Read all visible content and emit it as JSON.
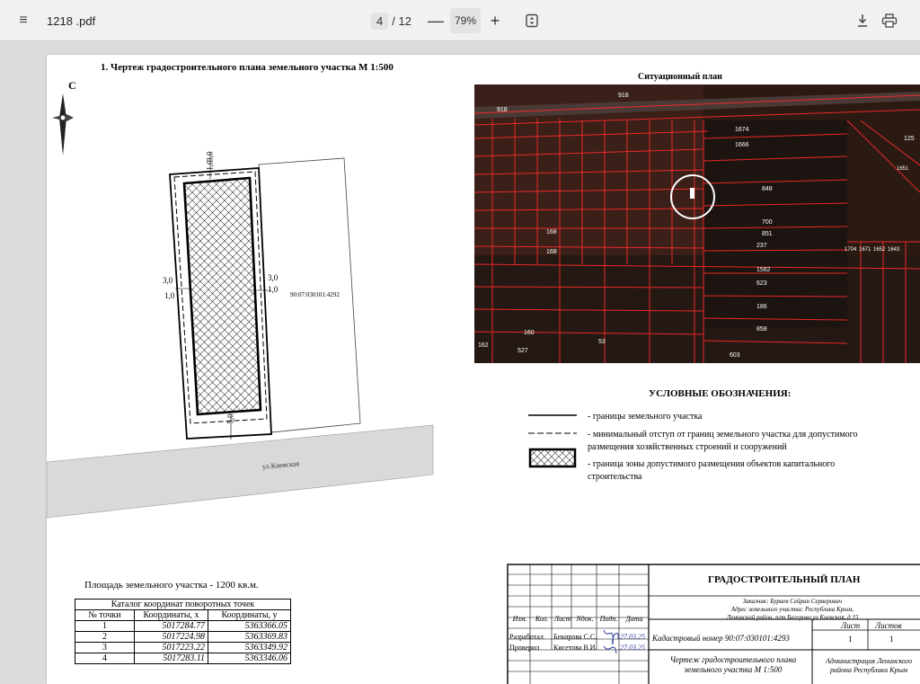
{
  "toolbar": {
    "file_name": "1218 .pdf",
    "page_current": "4",
    "page_total": "/ 12",
    "zoom": "79%",
    "zoom_out_symbol": "—",
    "zoom_in_symbol": "+",
    "menu_symbol": "≡"
  },
  "drawing": {
    "title": "1. Чертеж градостроительного плана земельного участка М 1:500",
    "north": "С",
    "cadastral_label": "90:07:030101:4292",
    "street": "ул.Киевская",
    "dims": {
      "top1": "3,0",
      "top2": "1,0",
      "left1": "3,0",
      "left2": "1,0",
      "right1": "3,0",
      "right2": "1,0",
      "bottom": "5,0"
    }
  },
  "site_plan": {
    "title": "Ситуационный план",
    "labels": [
      "918",
      "918",
      "1674",
      "1666",
      "848",
      "700",
      "851",
      "237",
      "1562",
      "623",
      "186",
      "858",
      "603",
      "168",
      "168",
      "160",
      "527",
      "162",
      "53",
      "1704",
      "1671",
      "1652",
      "1643",
      "1651",
      "125"
    ]
  },
  "legend": {
    "title": "УСЛОВНЫЕ ОБОЗНАЧЕНИЯ:",
    "items": [
      "- границы земельного участка",
      "- минимальный отступ от границ земельного участка для допустимого размещения хозяйственных строений и сооружений",
      "- граница зоны допустимого размещения объектов капитального строительства"
    ]
  },
  "area": "Площадь земельного участка - 1200 кв.м.",
  "coords_table": {
    "caption": "Каталог координат поворотных точек",
    "headers": [
      "№ точки",
      "Координаты, х",
      "Координаты, у"
    ],
    "rows": [
      [
        "1",
        "5017284.77",
        "5363366.05"
      ],
      [
        "2",
        "5017224.98",
        "5363369.83"
      ],
      [
        "3",
        "5017223.22",
        "5363349.92"
      ],
      [
        "4",
        "5017283.11",
        "5363346.06"
      ]
    ]
  },
  "title_block": {
    "heading": "ГРАДОСТРОИТЕЛЬНЫЙ ПЛАН",
    "customer": "Заказчик: Бураев Сейран Серверович",
    "address1": "Адрес земельного участка: Республика Крым,",
    "address2": "Ленинский район, пгт Багерово ул Киевская, д 15",
    "cols": [
      "Изм.",
      "Кол.",
      "Лист",
      "Nдок.",
      "Подп.",
      "Дата"
    ],
    "dev_role": "Разработал",
    "dev_name": "Бекирова С.С.",
    "chk_role": "Проверил",
    "chk_name": "Кисетова В.И.",
    "date1": "27.03.25",
    "date2": "27.03.25",
    "cadastral": "Кадастровый номер 90:07:030101:4293",
    "sheet_label": "Лист",
    "sheets_label": "Листов",
    "sheet_val": "1",
    "sheets_val": "1",
    "drawing_name1": "Чертеж градостроительного плана",
    "drawing_name2": "земельного участка М 1:500",
    "org1": "Администрация Ленинского",
    "org2": "района Республики Крым"
  }
}
